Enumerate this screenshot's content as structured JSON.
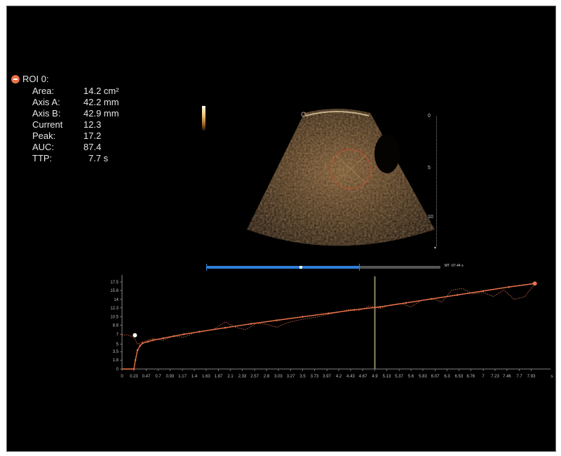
{
  "roi": {
    "title": "ROI 0:",
    "metrics": [
      {
        "label": "Area:",
        "value": "14.2 cm²"
      },
      {
        "label": "Axis A:",
        "value": "42.2 mm"
      },
      {
        "label": "Axis B:",
        "value": "42.9 mm"
      },
      {
        "label": "Current",
        "value": "12.3"
      },
      {
        "label": "Peak:",
        "value": "17.2"
      },
      {
        "label": "AUC:",
        "value": "87.4"
      },
      {
        "label": "TTP:",
        "value": "7.7 s"
      }
    ]
  },
  "depth_scale": [
    "0",
    "5",
    "10"
  ],
  "timeline": {
    "label": "MT -07.44 s"
  },
  "colors": {
    "curve": "#e8734a",
    "timeline": "#2f7fd6",
    "cursor": "#8c8a5c",
    "axis": "#aaaaaa"
  },
  "chart_data": {
    "type": "line",
    "x_ticks": [
      "0",
      "0.23",
      "0.47",
      "0.7",
      "0.93",
      "1.17",
      "1.4",
      "1.63",
      "1.87",
      "2.1",
      "2.33",
      "2.57",
      "2.8",
      "3.03",
      "3.27",
      "3.5",
      "3.73",
      "3.97",
      "4.2",
      "4.43",
      "4.67",
      "4.9",
      "5.13",
      "5.37",
      "5.6",
      "5.83",
      "6.07",
      "6.3",
      "6.53",
      "6.76",
      "7",
      "7.23",
      "7.46",
      "7.7",
      "7.93"
    ],
    "x_unit": "s",
    "y_ticks": [
      "0",
      "1.8",
      "3.5",
      "5",
      "7",
      "8.8",
      "10.5",
      "12.3",
      "14",
      "15.8",
      "17.5"
    ],
    "xlim": [
      0,
      8.1
    ],
    "ylim": [
      0,
      17.5
    ],
    "cursor_x": 4.9,
    "series": [
      {
        "role": "fit",
        "x": [
          0,
          0.23,
          0.26,
          0.3,
          0.35,
          0.4,
          0.5,
          0.6,
          0.8,
          1.0,
          1.2,
          1.5,
          2.0,
          2.5,
          3.0,
          3.5,
          4.0,
          4.5,
          5.0,
          5.5,
          6.0,
          6.5,
          7.0,
          7.5,
          8.0
        ],
        "y": [
          0,
          0,
          1.8,
          3.8,
          4.7,
          5.2,
          5.5,
          5.8,
          6.2,
          6.6,
          7.0,
          7.5,
          8.3,
          9.1,
          9.8,
          10.5,
          11.2,
          11.9,
          12.5,
          13.3,
          14.1,
          14.9,
          15.7,
          16.5,
          17.2
        ]
      },
      {
        "role": "raw",
        "x": [
          0,
          0.1,
          0.2,
          0.25,
          0.3,
          0.4,
          0.6,
          0.8,
          1.0,
          1.2,
          1.4,
          1.6,
          1.8,
          2.0,
          2.2,
          2.4,
          2.6,
          2.8,
          3.0,
          3.2,
          3.4,
          3.6,
          3.8,
          4.0,
          4.2,
          4.4,
          4.6,
          4.8,
          5.0,
          5.2,
          5.4,
          5.6,
          5.8,
          6.0,
          6.2,
          6.4,
          6.6,
          6.8,
          7.0,
          7.2,
          7.4,
          7.6,
          7.8,
          8.0
        ],
        "y": [
          6.8,
          6.9,
          6.5,
          6.0,
          5.0,
          5.5,
          6.1,
          5.8,
          6.6,
          6.4,
          7.3,
          7.6,
          8.1,
          9.5,
          8.4,
          7.9,
          9.2,
          9.0,
          8.4,
          9.3,
          9.8,
          10.2,
          10.5,
          11.0,
          11.4,
          12.0,
          11.8,
          12.7,
          12.2,
          12.9,
          13.2,
          12.5,
          13.8,
          14.2,
          13.5,
          15.9,
          16.2,
          15.1,
          15.4,
          14.6,
          15.9,
          14.0,
          14.5,
          17.1
        ]
      }
    ],
    "start_marker": {
      "x": 0.25,
      "y": 6.8
    },
    "end_marker": {
      "x": 8.0,
      "y": 17.2
    }
  }
}
